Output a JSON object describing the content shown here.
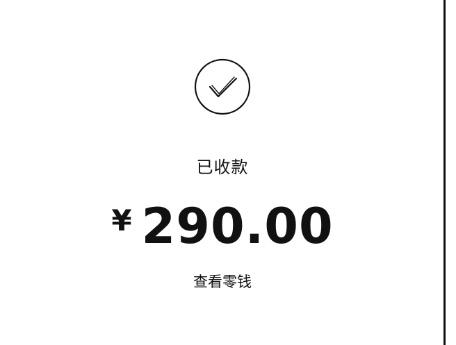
{
  "payment": {
    "status_label": "已收款",
    "currency_symbol": "¥",
    "amount": "290.00",
    "view_change_link": "查看零钱"
  },
  "icons": {
    "status": "check-circle-icon"
  },
  "colors": {
    "background": "#ffffff",
    "text": "#111111"
  }
}
